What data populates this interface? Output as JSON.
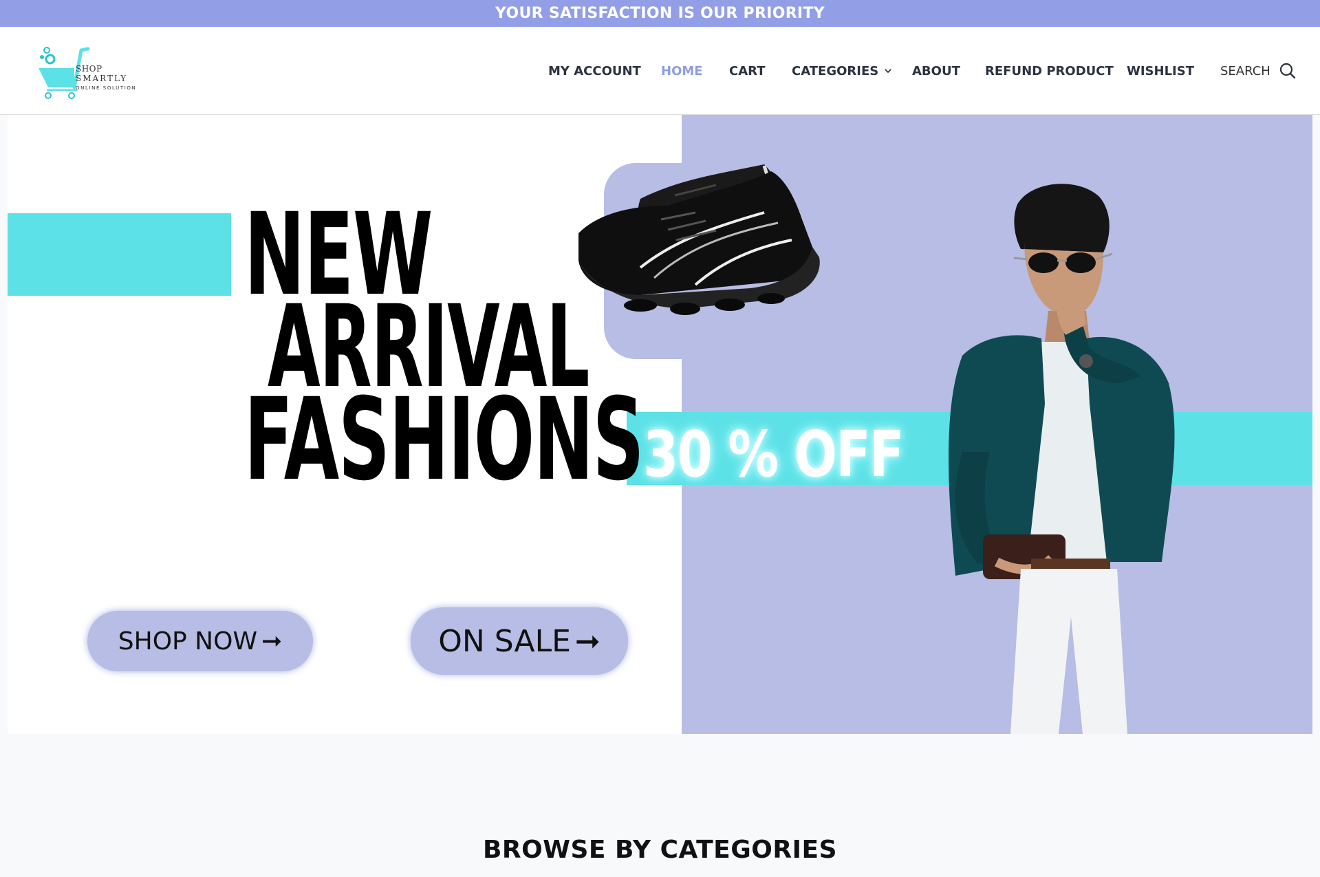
{
  "announcement": "YOUR SATISFACTION IS OUR PRIORITY",
  "logo": {
    "line1": "SHOP",
    "line2": "SMARTLY",
    "line3": "ONLINE SOLUTION"
  },
  "nav": {
    "items": [
      {
        "label": "MY ACCOUNT"
      },
      {
        "label": "HOME"
      },
      {
        "label": "CART"
      },
      {
        "label": "CATEGORIES"
      },
      {
        "label": "ABOUT"
      },
      {
        "label": "REFUND PRODUCT"
      },
      {
        "label": "WISHLIST"
      }
    ],
    "active": "HOME",
    "search_label": "SEARCH"
  },
  "hero": {
    "headline_line1": "NEW",
    "headline_line2": "ARRIVAL",
    "headline_line3": "FASHIONS",
    "discount": "30 % OFF",
    "shop_now_label": "SHOP NOW",
    "on_sale_label": "ON SALE"
  },
  "section": {
    "title": "BROWSE BY CATEGORIES"
  },
  "colors": {
    "accent_purple": "#929fe6",
    "hero_lavender": "#b7bde4",
    "cyan": "#5ce1e6",
    "nav_text": "#2b3240",
    "nav_active": "#8f9de3"
  },
  "icons": {
    "logo": "shopping-cart-icon",
    "categories_dropdown": "chevron-down-icon",
    "search": "search-icon",
    "button_arrow": "arrow-right-icon"
  }
}
